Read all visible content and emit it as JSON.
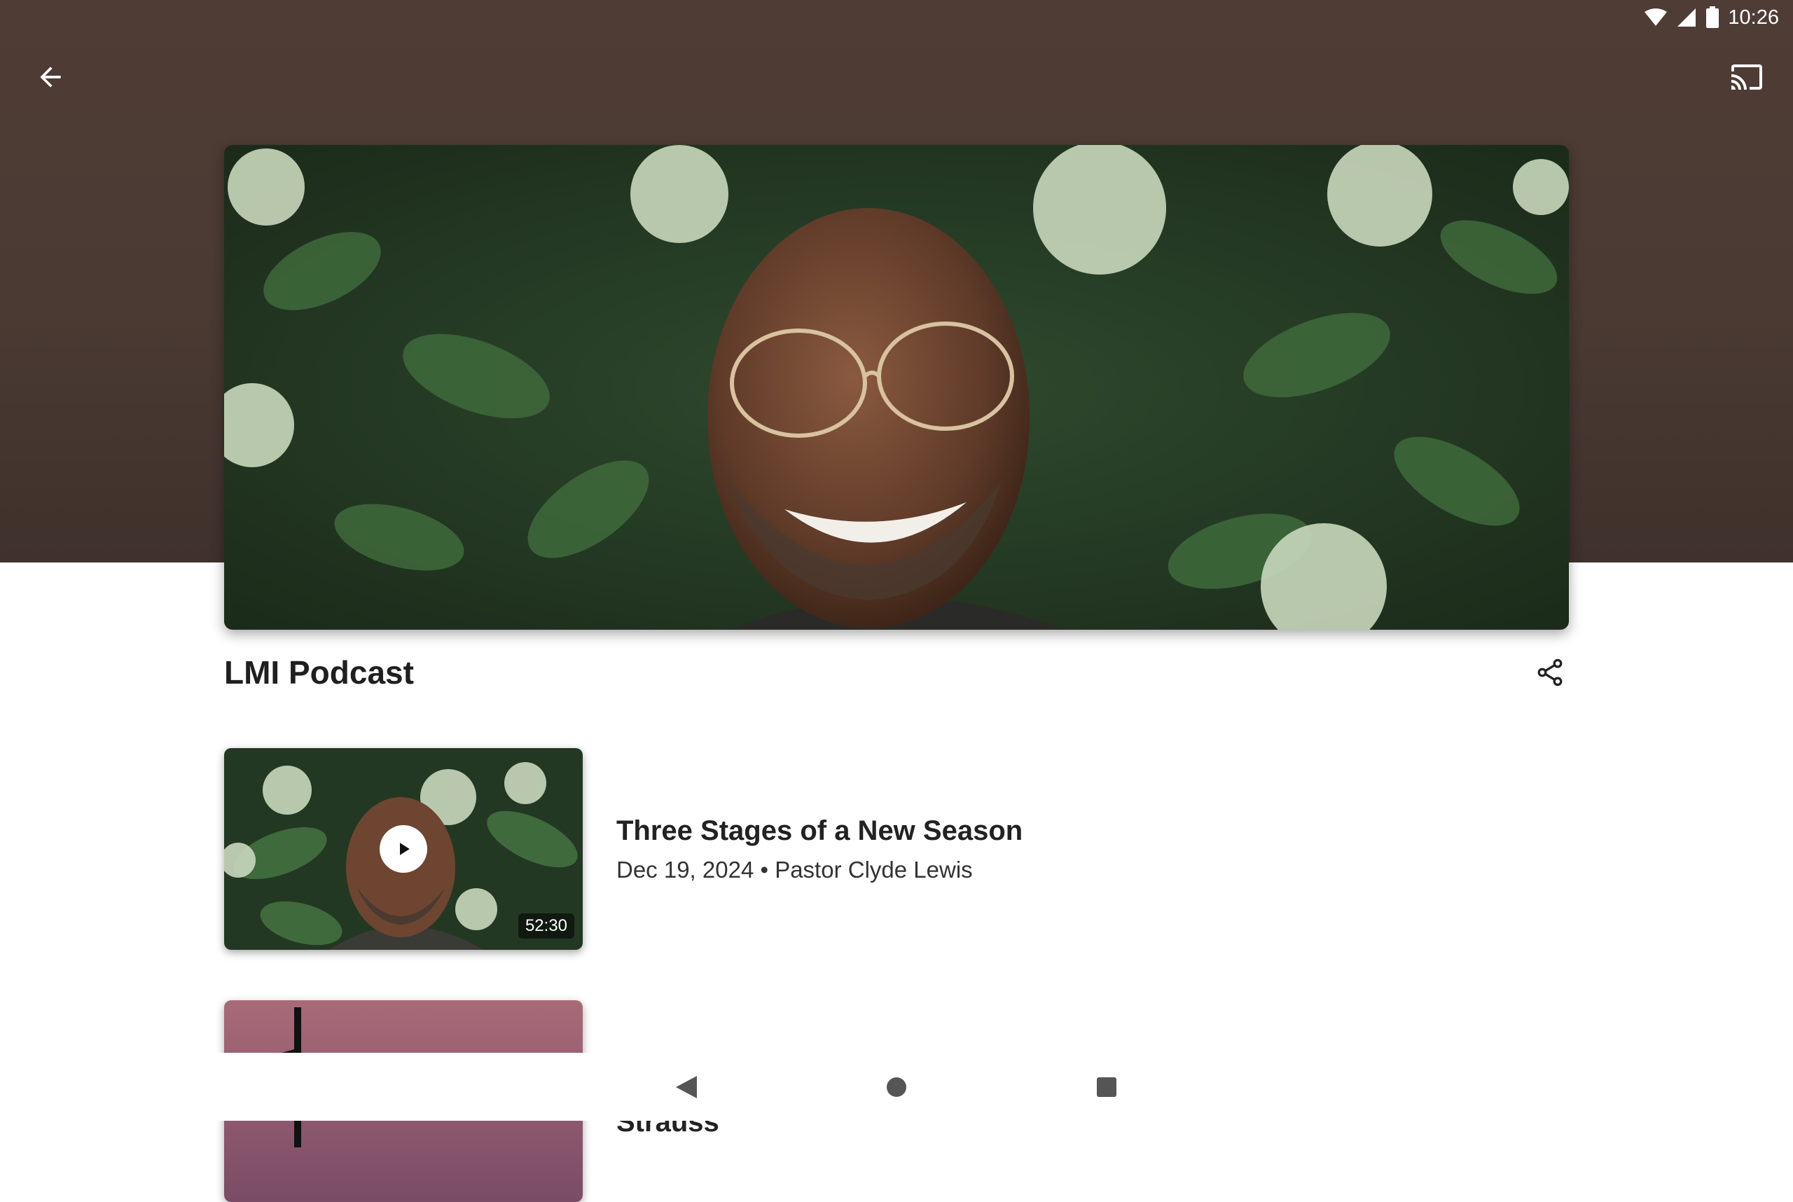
{
  "status_bar": {
    "time": "10:26",
    "icons": [
      "wifi-icon",
      "signal-icon",
      "battery-icon"
    ]
  },
  "toolbar": {
    "back_icon": "arrow-left-icon",
    "cast_icon": "cast-icon"
  },
  "podcast": {
    "title": "LMI Podcast",
    "share_icon": "share-icon"
  },
  "episodes": [
    {
      "title": "Three Stages of a New Season",
      "meta": "Dec 19, 2024 • Pastor Clyde Lewis",
      "duration": "52:30"
    },
    {
      "title": "Accessing the courts of heaven podcast interview with Jeanette Strauss"
    }
  ],
  "nav_bar": {
    "icons": [
      "back-triangle-icon",
      "home-circle-icon",
      "recents-square-icon"
    ]
  },
  "colors": {
    "header_bg": "#4a3a33",
    "title_text": "#1f1f1f"
  }
}
